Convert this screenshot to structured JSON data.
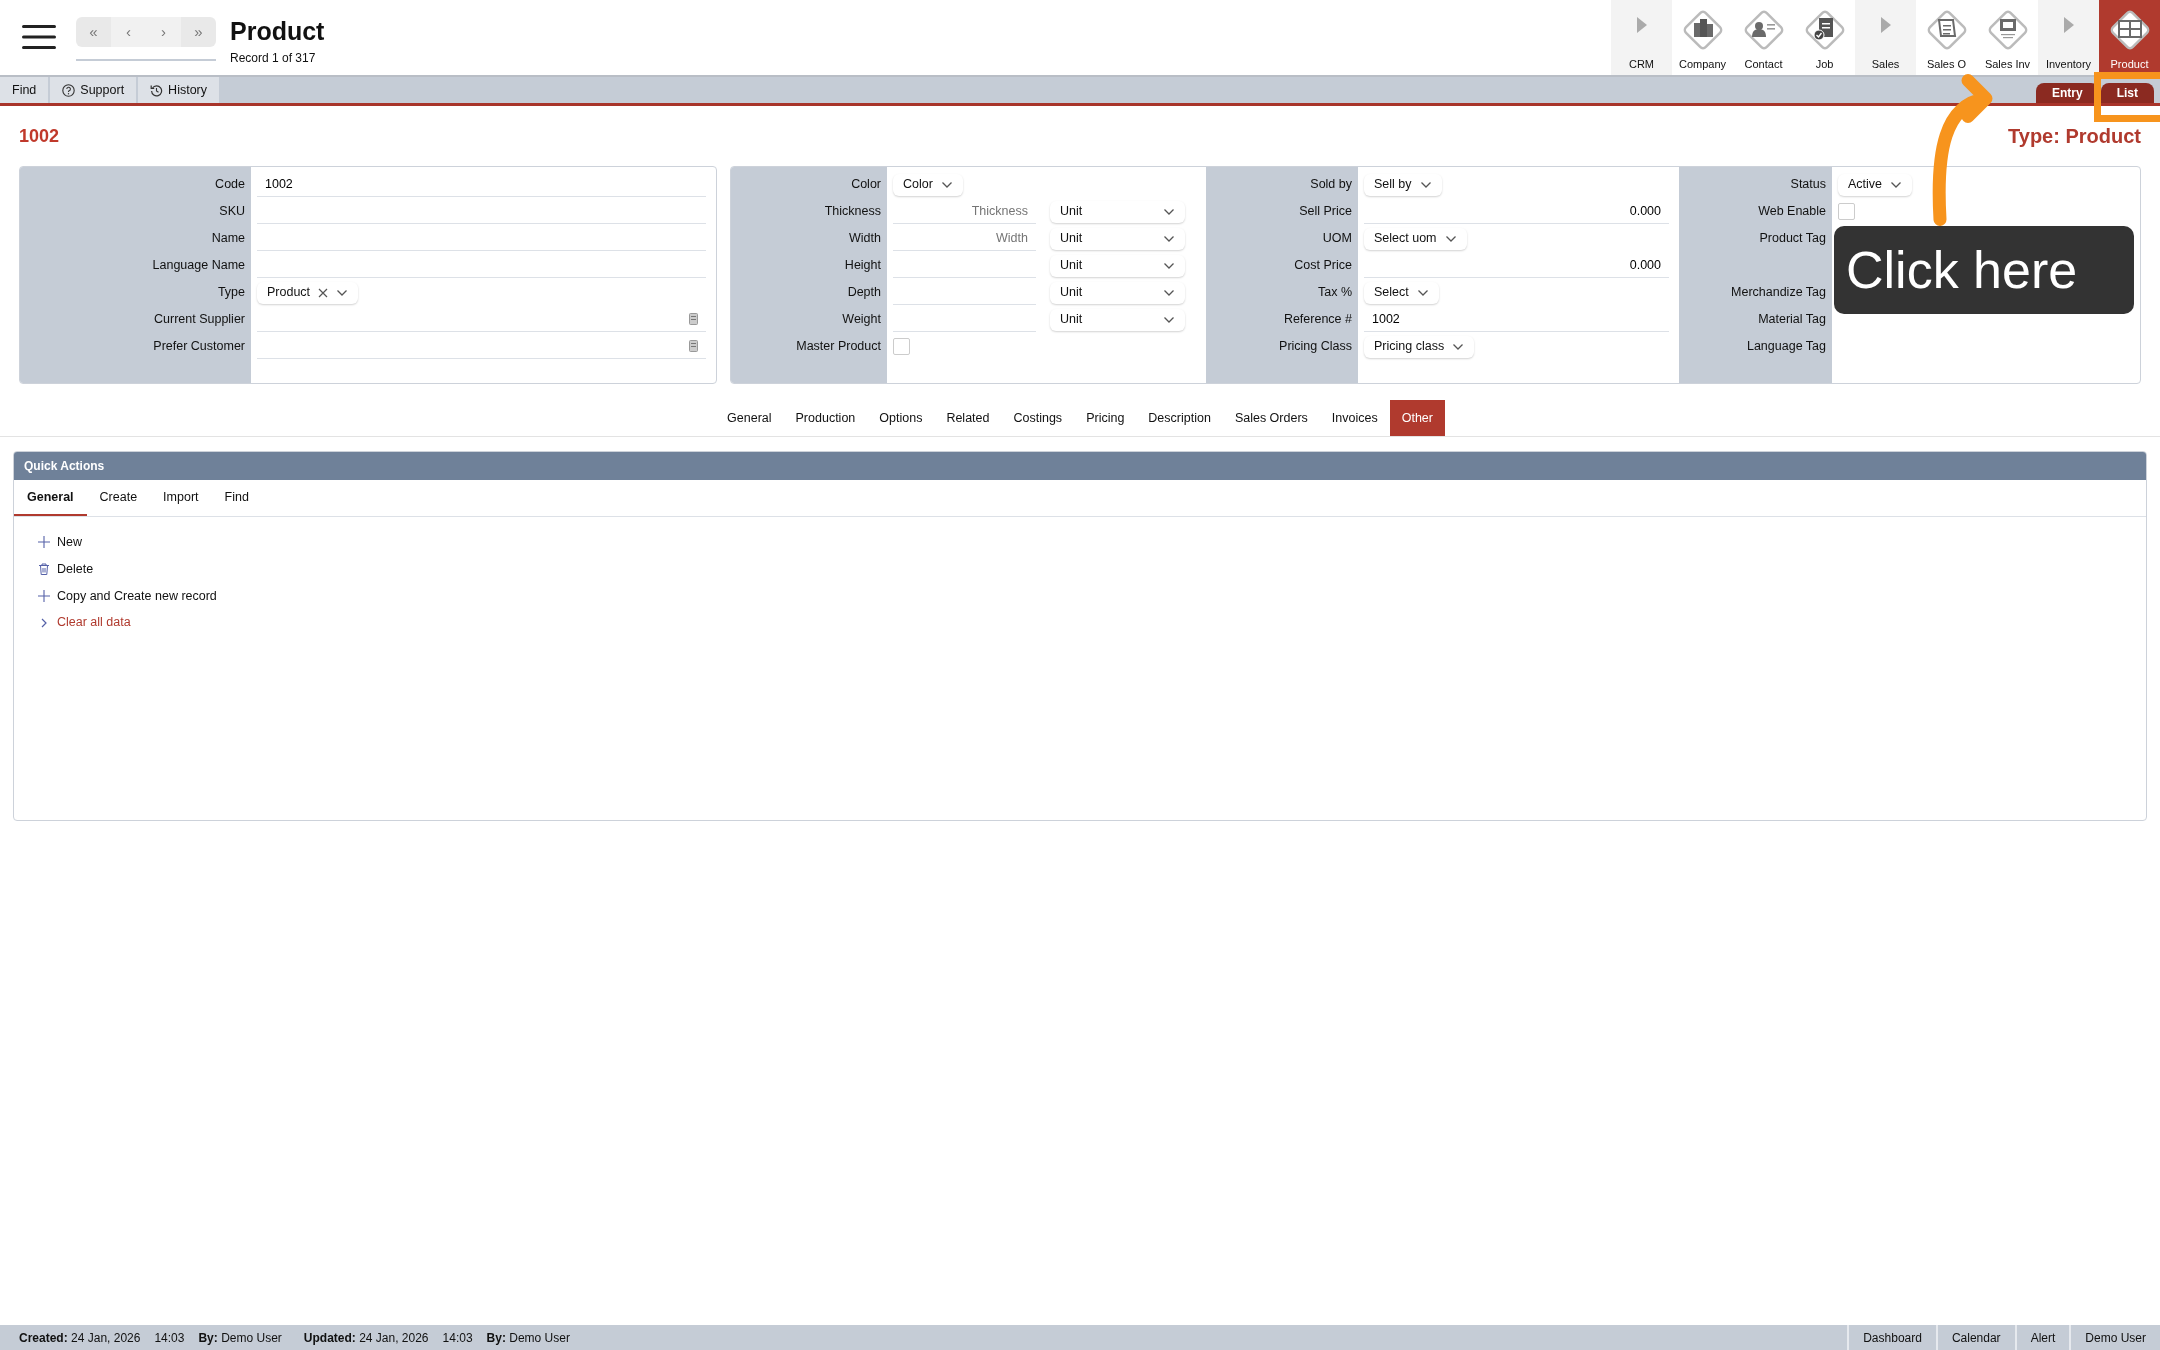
{
  "header": {
    "title": "Product",
    "subtitle": "Record 1 of 317",
    "nav_buttons": [
      "«",
      "‹",
      "›",
      "»"
    ]
  },
  "modules": [
    {
      "label": "CRM",
      "kind": "group",
      "selected": false
    },
    {
      "label": "Company",
      "kind": "module",
      "selected": false
    },
    {
      "label": "Contact",
      "kind": "module",
      "selected": false
    },
    {
      "label": "Job",
      "kind": "module",
      "selected": false
    },
    {
      "label": "Sales",
      "kind": "group",
      "selected": false
    },
    {
      "label": "Sales O",
      "kind": "module",
      "selected": false
    },
    {
      "label": "Sales Inv",
      "kind": "module",
      "selected": false
    },
    {
      "label": "Inventory",
      "kind": "group",
      "selected": false
    },
    {
      "label": "Product",
      "kind": "module",
      "selected": true
    }
  ],
  "toolbar": [
    {
      "label": "Find",
      "kind": "plain"
    },
    {
      "label": "Support",
      "kind": "help"
    },
    {
      "label": "History",
      "kind": "history"
    }
  ],
  "view_tabs": [
    "Entry",
    "List"
  ],
  "record": {
    "heading": "1002",
    "type_label": "Type: Product"
  },
  "form_cards": [
    {
      "sections": [
        {
          "rows": [
            {
              "label": "Code",
              "kind": "text",
              "value": "1002"
            },
            {
              "label": "SKU",
              "kind": "text"
            },
            {
              "label": "Name",
              "kind": "text"
            },
            {
              "label": "Language Name",
              "kind": "text"
            },
            {
              "label": "Type",
              "kind": "select",
              "value": "Product",
              "clearable": true
            },
            {
              "label": "Current Supplier",
              "kind": "lookup"
            },
            {
              "label": "Prefer Customer",
              "kind": "lookup"
            }
          ]
        }
      ]
    },
    {
      "sections": [
        {
          "rows": [
            {
              "label": "Color",
              "kind": "select",
              "value": "Color"
            },
            {
              "label": "Thickness",
              "kind": "dimension",
              "placeholder": "Thickness",
              "unit": "Unit"
            },
            {
              "label": "Width",
              "kind": "dimension",
              "placeholder": "Width",
              "unit": "Unit"
            },
            {
              "label": "Height",
              "kind": "dimension",
              "unit": "Unit"
            },
            {
              "label": "Depth",
              "kind": "dimension",
              "unit": "Unit"
            },
            {
              "label": "Weight",
              "kind": "dimension",
              "unit": "Unit"
            },
            {
              "label": "Master Product",
              "kind": "checkbox",
              "checked": false
            }
          ]
        },
        {
          "rows": [
            {
              "label": "Sold by",
              "kind": "select",
              "value": "Sell by"
            },
            {
              "label": "Sell Price",
              "kind": "number",
              "value": "0.000"
            },
            {
              "label": "UOM",
              "kind": "select",
              "value": "Select uom"
            },
            {
              "label": "Cost Price",
              "kind": "number",
              "value": "0.000"
            },
            {
              "label": "Tax %",
              "kind": "select",
              "value": "Select"
            },
            {
              "label": "Reference #",
              "kind": "text",
              "value": "1002"
            },
            {
              "label": "Pricing Class",
              "kind": "select",
              "value": "Pricing class"
            }
          ]
        },
        {
          "rows": [
            {
              "label": "Status",
              "kind": "select",
              "value": "Active"
            },
            {
              "label": "Web Enable",
              "kind": "checkbox",
              "checked": false
            },
            {
              "label": "Product Tag",
              "kind": "blank"
            },
            {
              "label": "",
              "kind": "blank"
            },
            {
              "label": "Merchandize Tag",
              "kind": "blank"
            },
            {
              "label": "Material Tag",
              "kind": "blank"
            },
            {
              "label": "Language Tag",
              "kind": "blank"
            }
          ]
        }
      ]
    }
  ],
  "tabs": [
    {
      "label": "General",
      "selected": false
    },
    {
      "label": "Production",
      "selected": false
    },
    {
      "label": "Options",
      "selected": false
    },
    {
      "label": "Related",
      "selected": false
    },
    {
      "label": "Costings",
      "selected": false
    },
    {
      "label": "Pricing",
      "selected": false
    },
    {
      "label": "Description",
      "selected": false
    },
    {
      "label": "Sales Orders",
      "selected": false
    },
    {
      "label": "Invoices",
      "selected": false
    },
    {
      "label": "Other",
      "selected": true
    }
  ],
  "quick_actions": {
    "title": "Quick Actions",
    "tabs": [
      {
        "label": "General",
        "selected": true
      },
      {
        "label": "Create",
        "selected": false
      },
      {
        "label": "Import",
        "selected": false
      },
      {
        "label": "Find",
        "selected": false
      }
    ],
    "actions": [
      {
        "label": "New",
        "kind": "add"
      },
      {
        "label": "Delete",
        "kind": "delete"
      },
      {
        "label": "Copy and Create new record",
        "kind": "add"
      },
      {
        "label": "Clear all data",
        "kind": "danger"
      }
    ]
  },
  "status_bar": {
    "entries": [
      {
        "label": "Created:",
        "date": "24 Jan, 2026",
        "time": "14:03",
        "by_label": "By:",
        "by": "Demo User"
      },
      {
        "label": "Updated:",
        "date": "24 Jan, 2026",
        "time": "14:03",
        "by_label": "By:",
        "by": "Demo User"
      }
    ],
    "links": [
      "Dashboard",
      "Calendar",
      "Alert",
      "Demo User"
    ]
  },
  "tooltip": {
    "text": "Click here"
  }
}
